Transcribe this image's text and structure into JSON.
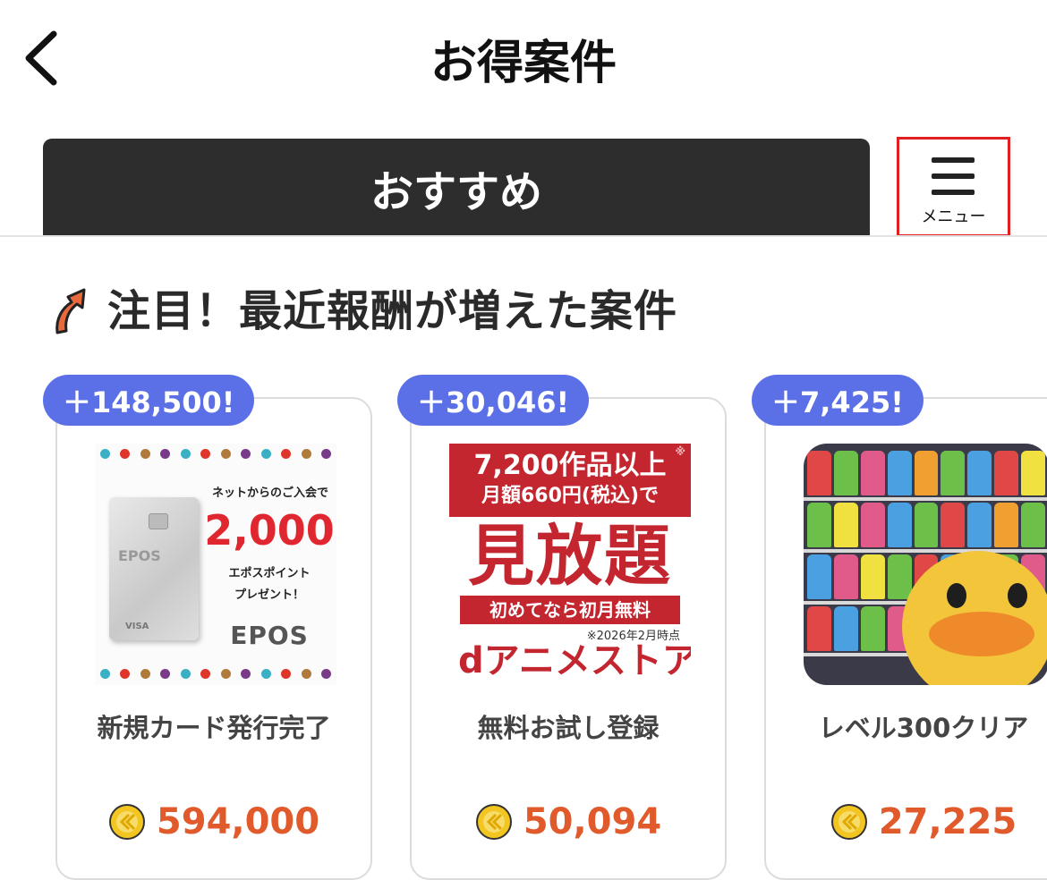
{
  "header": {
    "title": "お得案件"
  },
  "tabs": {
    "active_label": "おすすめ",
    "menu_label": "メニュー"
  },
  "section": {
    "title": "注目！最近報酬が増えた案件"
  },
  "cards": [
    {
      "badge": "＋148,500!",
      "name": "新規カード発行完了",
      "reward": "594,000",
      "thumb": {
        "line1": "ネットからのご入会で",
        "amount": "2,000",
        "line2": "エポスポイント",
        "line3": "プレゼント！",
        "logo": "EPOS",
        "card_brand": "EPOS",
        "card_network": "VISA"
      }
    },
    {
      "badge": "＋30,046!",
      "name": "無料お試し登録",
      "reward": "50,094",
      "thumb": {
        "line1": "7,200作品以上",
        "line2": "月額660円(税込)で",
        "big": "見放題",
        "band": "初めてなら初月無料",
        "note": "※2026年2月時点",
        "logo": "dアニメストア",
        "mark": "※"
      }
    },
    {
      "badge": "＋7,425!",
      "name": "レベル300クリア",
      "reward": "27,225"
    }
  ],
  "colors": {
    "accent_badge": "#5b6fe6",
    "reward_text": "#e05a2c",
    "tab_active_bg": "#2d2d2d",
    "menu_highlight": "#e02020",
    "anime_red": "#c3262f",
    "epos_red": "#e0262e"
  },
  "icons": {
    "back": "chevron-left-icon",
    "menu": "hamburger-icon",
    "section": "trend-up-arrow-icon",
    "coin": "coin-icon"
  }
}
